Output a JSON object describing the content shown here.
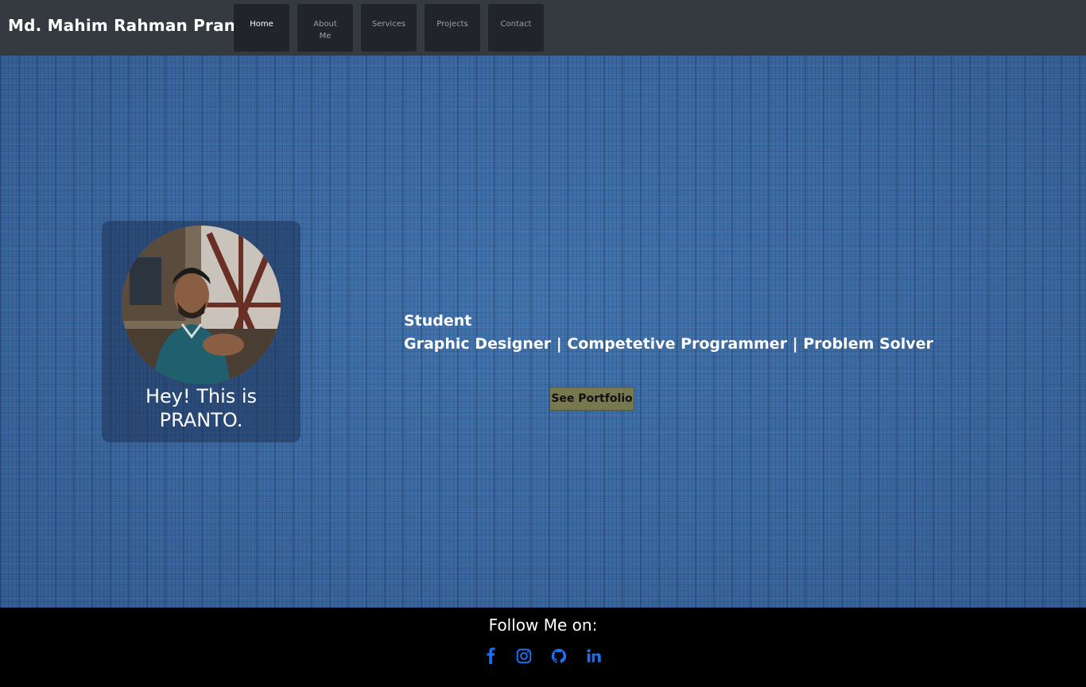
{
  "header": {
    "brand": "Md. Mahim Rahman Pranto",
    "nav": [
      {
        "label": "Home",
        "active": true
      },
      {
        "label": "About Me"
      },
      {
        "label": "Services"
      },
      {
        "label": "Projects"
      },
      {
        "label": "Contact"
      }
    ]
  },
  "hero": {
    "greeting": "Hey! This is PRANTO.",
    "title_line1": "Student",
    "title_line2": "Graphic Designer | Competetive Programmer | Problem Solver",
    "button_label": "See Portfolio"
  },
  "footer": {
    "follow_text": "Follow Me on:",
    "social_icons": [
      "facebook-icon",
      "instagram-icon",
      "github-icon",
      "linkedin-icon"
    ],
    "icon_color": "#1e6ff0"
  },
  "colors": {
    "header_bg": "#343a40",
    "nav_btn_bg": "#212529",
    "hero_bg": "#3c6ea8",
    "button_bg": "#787850"
  }
}
